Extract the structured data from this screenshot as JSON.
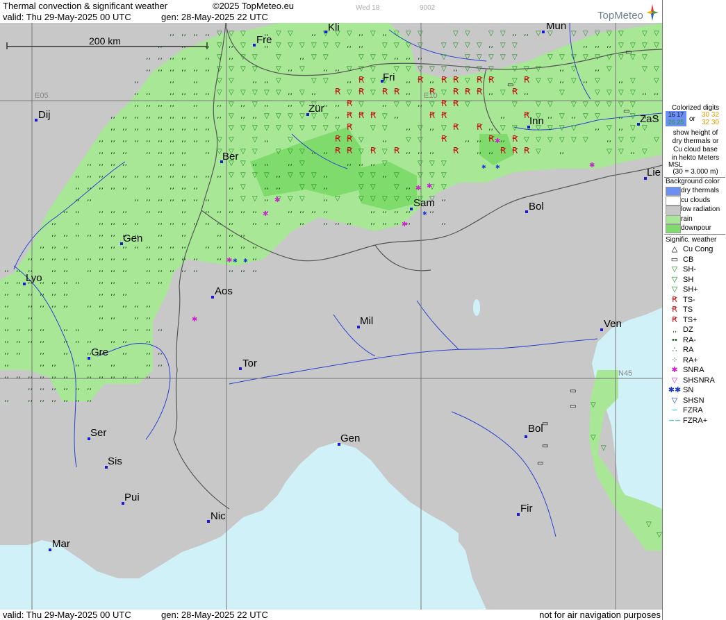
{
  "header": {
    "title": "Thermal convection & significant weather",
    "copyright": "©2025 TopMeteo.eu",
    "valid": "valid:  Thu  29-May-2025  00 UTC",
    "generated": "gen: 28-May-2025 22 UTC",
    "faint_a": "Wed 18",
    "faint_b": "9002",
    "logo": "TopMeteo"
  },
  "footer": {
    "valid": "valid:  Thu  29-May-2025  00 UTC",
    "generated": "gen: 28-May-2025 22 UTC",
    "disclaimer": "not for air navigation purposes"
  },
  "map": {
    "scale_label": "200 km",
    "grid_labels": [
      "E05",
      "E10",
      "N45"
    ],
    "colors": {
      "land": "#c8c8c8",
      "sea": "#cff1f7",
      "rain": "#a7e795",
      "downpour": "#7fdc6c",
      "border": "#555555",
      "river": "#2a3fd0"
    },
    "cities": [
      "Kli",
      "Mun",
      "Fre",
      "Fri",
      "Dij",
      "Zür",
      "Inn",
      "ZaS",
      "Ber",
      "Lie",
      "Sam",
      "Bol",
      "Gen",
      "Lyo",
      "Aos",
      "Mil",
      "Ven",
      "Gre",
      "Tor",
      "N45",
      "Bol",
      "Ser",
      "Gen",
      "Sis",
      "Pui",
      "Fir",
      "Nic",
      "Mar"
    ]
  },
  "legend": {
    "digits_title": [
      "Colorized digits"
    ],
    "digits_examples": [
      "16 17",
      "30 32",
      "26 25",
      "32 30"
    ],
    "digits_or": "or",
    "digits_desc": [
      "show height of",
      "dry thermals or",
      "Cu cloud base",
      "in hekto Meters",
      "MSL",
      "(30 = 3.000 m)"
    ],
    "bg_title": "Background color",
    "bg_items": [
      {
        "label": "dry thermals",
        "color": "#6b8ff2"
      },
      {
        "label": "cu clouds",
        "color": "#ffffff"
      },
      {
        "label": "low radiation",
        "color": "#c8c8c8"
      },
      {
        "label": "rain",
        "color": "#a7e795"
      },
      {
        "label": "downpour",
        "color": "#7fdc6c"
      }
    ],
    "weather_title": "Signific. weather",
    "weather_items": [
      {
        "label": "Cu Cong",
        "icon": "cu-cong-icon"
      },
      {
        "label": "CB",
        "icon": "cb-icon"
      },
      {
        "label": "SH-",
        "icon": "shower-light-icon"
      },
      {
        "label": "SH",
        "icon": "shower-icon"
      },
      {
        "label": "SH+",
        "icon": "shower-heavy-icon"
      },
      {
        "label": "TS-",
        "icon": "thunderstorm-light-icon"
      },
      {
        "label": "TS",
        "icon": "thunderstorm-icon"
      },
      {
        "label": "TS+",
        "icon": "thunderstorm-heavy-icon"
      },
      {
        "label": "DZ",
        "icon": "drizzle-icon"
      },
      {
        "label": "RA-",
        "icon": "rain-light-icon"
      },
      {
        "label": "RA",
        "icon": "rain-icon"
      },
      {
        "label": "RA+",
        "icon": "rain-heavy-icon"
      },
      {
        "label": "SNRA",
        "icon": "snow-rain-icon"
      },
      {
        "label": "SHSNRA",
        "icon": "snow-rain-shower-icon"
      },
      {
        "label": "SN",
        "icon": "snow-icon"
      },
      {
        "label": "SHSN",
        "icon": "snow-shower-icon"
      },
      {
        "label": "FZRA",
        "icon": "freezing-rain-icon"
      },
      {
        "label": "FZRA+",
        "icon": "freezing-rain-heavy-icon"
      }
    ]
  }
}
